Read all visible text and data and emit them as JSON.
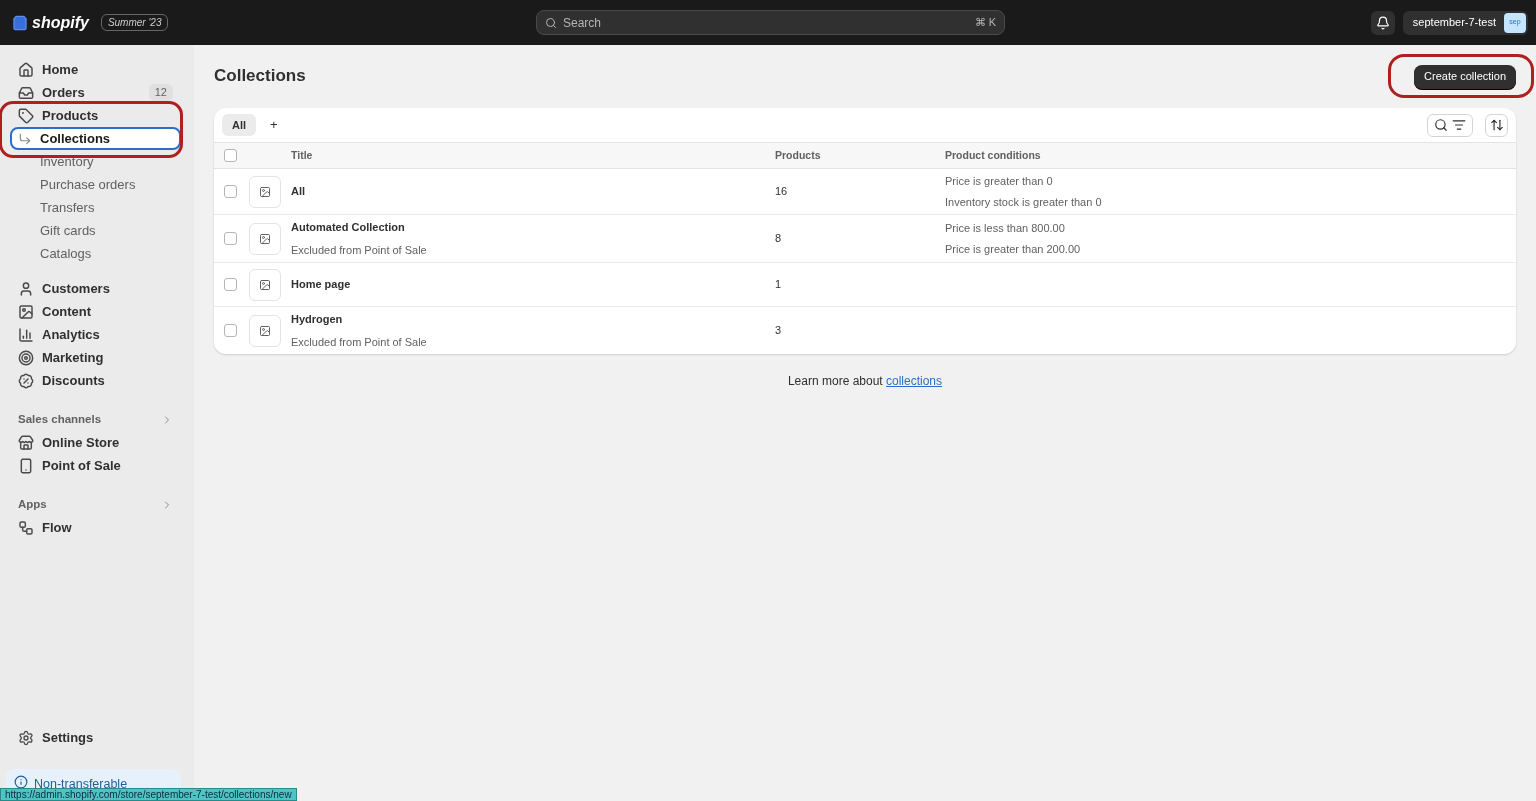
{
  "topbar": {
    "brand": "shopify",
    "edition": "Summer '23",
    "search": {
      "placeholder": "Search",
      "shortcut": "⌘ K"
    },
    "store": {
      "name": "september-7-test",
      "avatar": "sep"
    }
  },
  "sidebar": {
    "groups": [
      {
        "items": [
          {
            "label": "Home",
            "kind": "home",
            "selected": false
          },
          {
            "label": "Orders",
            "kind": "orders",
            "selected": false,
            "count": "12"
          },
          {
            "label": "Products",
            "kind": "tag",
            "selected": false,
            "highlighted": true,
            "children": [
              {
                "label": "Collections",
                "selected": true
              },
              {
                "label": "Inventory",
                "selected": false
              },
              {
                "label": "Purchase orders",
                "selected": false
              },
              {
                "label": "Transfers",
                "selected": false
              },
              {
                "label": "Gift cards",
                "selected": false
              },
              {
                "label": "Catalogs",
                "selected": false
              }
            ]
          }
        ]
      },
      {
        "items": [
          {
            "label": "Customers",
            "kind": "person",
            "selected": false
          },
          {
            "label": "Content",
            "kind": "content",
            "selected": false
          },
          {
            "label": "Analytics",
            "kind": "chart",
            "selected": false
          },
          {
            "label": "Marketing",
            "kind": "target",
            "selected": false
          },
          {
            "label": "Discounts",
            "kind": "discount",
            "selected": false
          }
        ]
      },
      {
        "heading": "Sales channels",
        "items": [
          {
            "label": "Online Store",
            "kind": "store",
            "selected": false
          },
          {
            "label": "Point of Sale",
            "kind": "pos",
            "selected": false
          }
        ]
      },
      {
        "heading": "Apps",
        "items": [
          {
            "label": "Flow",
            "kind": "flow",
            "selected": false
          }
        ]
      }
    ],
    "settings": "Settings",
    "banner": "Non-transferable"
  },
  "page": {
    "title": "Collections",
    "create_button": {
      "label": "Create collection",
      "highlighted": true
    }
  },
  "tabs": [
    {
      "label": "All",
      "selected": true
    }
  ],
  "add_tab": "+",
  "table": {
    "all_checked": false,
    "columns": [
      "Title",
      "Products",
      "Product conditions"
    ],
    "rows": [
      {
        "checked": false,
        "title": "All",
        "products": "16",
        "conditions": [
          "Price is greater than 0",
          "Inventory stock is greater than 0"
        ]
      },
      {
        "checked": false,
        "title": "Automated Collection",
        "subtitle": "Excluded from Point of Sale",
        "products": "8",
        "conditions": [
          "Price is less than 800.00",
          "Price is greater than 200.00"
        ]
      },
      {
        "checked": false,
        "title": "Home page",
        "products": "1",
        "conditions": []
      },
      {
        "checked": false,
        "title": "Hydrogen",
        "subtitle": "Excluded from Point of Sale",
        "products": "3",
        "conditions": []
      }
    ]
  },
  "footer": {
    "text": "Learn more about",
    "link": "collections"
  },
  "status_url": "https://admin.shopify.com/store/september-7-test/collections/new"
}
